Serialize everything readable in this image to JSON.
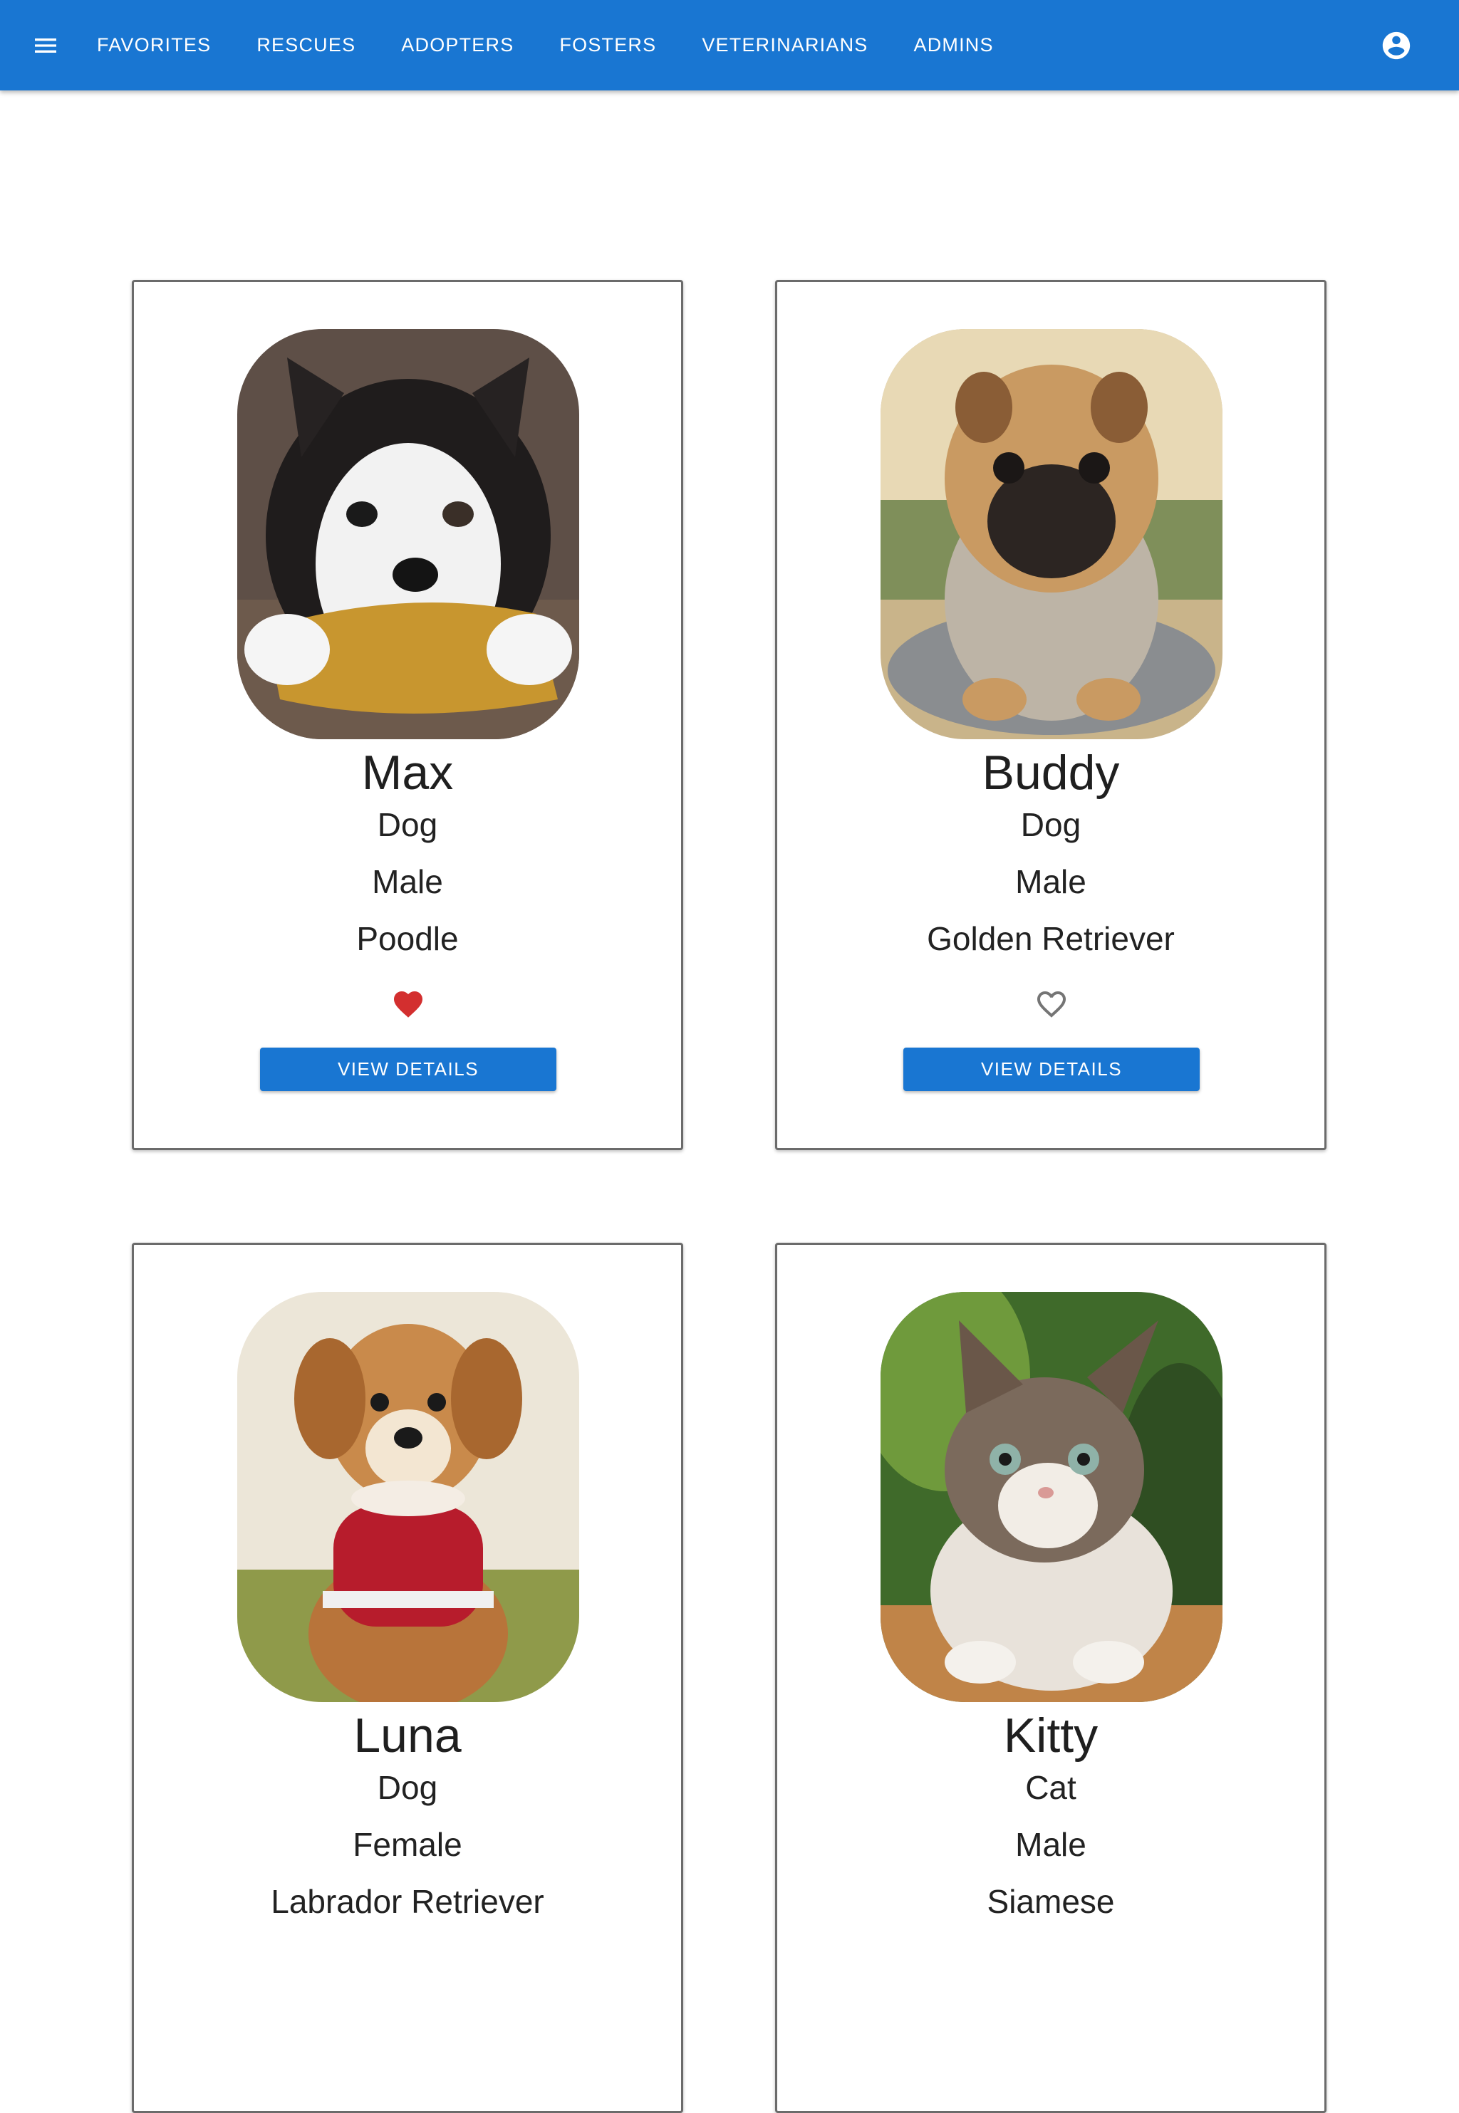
{
  "nav": {
    "items": [
      "FAVORITES",
      "RESCUES",
      "ADOPTERS",
      "FOSTERS",
      "VETERINARIANS",
      "ADMINS"
    ]
  },
  "icons": {
    "menu": "menu-icon",
    "account": "account-circle-icon",
    "favorite_filled": "heart-filled-icon",
    "favorite_outline": "heart-outline-icon"
  },
  "colors": {
    "primary": "#1976d2",
    "favorite": "#d32f2f",
    "favorite_outline": "#757575"
  },
  "pets": [
    {
      "name": "Max",
      "species": "Dog",
      "gender": "Male",
      "breed": "Poodle",
      "favorited": true,
      "button": "VIEW DETAILS"
    },
    {
      "name": "Buddy",
      "species": "Dog",
      "gender": "Male",
      "breed": "Golden Retriever",
      "favorited": false,
      "button": "VIEW DETAILS"
    },
    {
      "name": "Luna",
      "species": "Dog",
      "gender": "Female",
      "breed": "Labrador Retriever"
    },
    {
      "name": "Kitty",
      "species": "Cat",
      "gender": "Male",
      "breed": "Siamese"
    }
  ]
}
